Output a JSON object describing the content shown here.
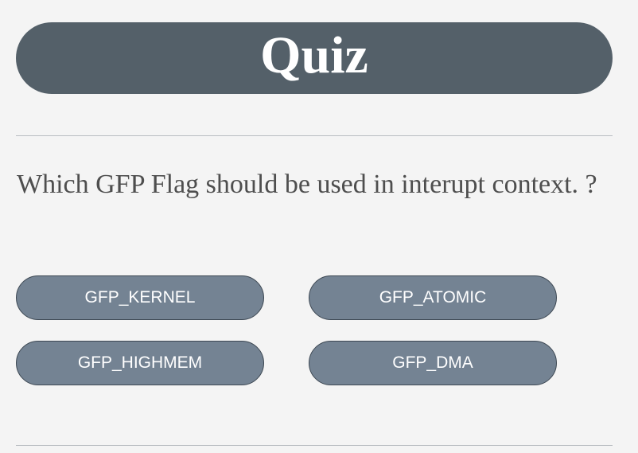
{
  "quiz": {
    "title": "Quiz",
    "question": "Which GFP Flag should be used in interupt context. ?",
    "options": [
      {
        "label": "GFP_KERNEL"
      },
      {
        "label": "GFP_ATOMIC"
      },
      {
        "label": "GFP_HIGHMEM"
      },
      {
        "label": "GFP_DMA"
      }
    ]
  },
  "colors": {
    "title_bar": "#546069",
    "option_button": "#748393",
    "background": "#f4f4f4",
    "question_text": "#4e4e4e"
  }
}
